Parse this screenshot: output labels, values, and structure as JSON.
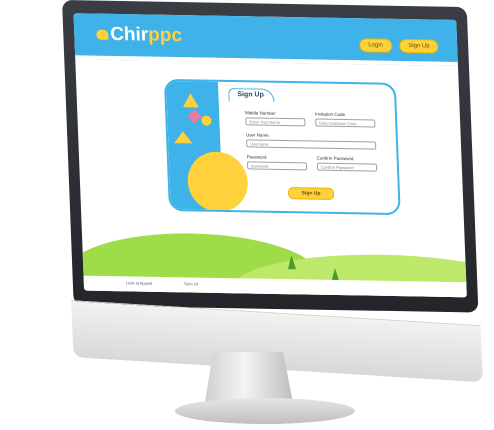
{
  "header": {
    "logo_prefix": "Chir",
    "logo_highlight": "ppc",
    "login_label": "Login",
    "signup_label": "Sign Up"
  },
  "form": {
    "title": "Sign Up",
    "fields": {
      "name": {
        "label": "Middle Number",
        "placeholder": "Enter Your Name"
      },
      "invite": {
        "label": "Invitation Code",
        "placeholder": "Enter Invitation Code"
      },
      "username": {
        "label": "User Name",
        "placeholder": "Username"
      },
      "password": {
        "label": "Password",
        "placeholder": "password"
      },
      "confirm": {
        "label": "Confirm Password",
        "placeholder": "Confirm Password"
      }
    },
    "submit_label": "Sign Up"
  },
  "footer": {
    "link1": "Look at Appeal",
    "link2": "Term Of"
  },
  "colors": {
    "primary": "#3fb3e9",
    "accent": "#ffd23c",
    "pink": "#e97c9d",
    "grass": "#9fdc49"
  }
}
